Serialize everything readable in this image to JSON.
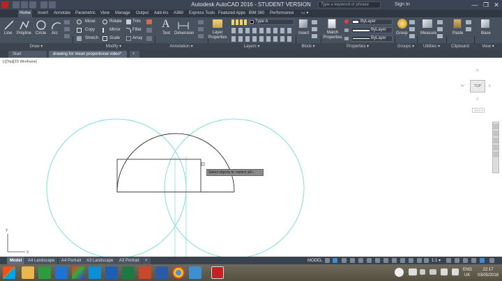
{
  "window": {
    "title": "Autodesk AutoCAD 2016 - STUDENT VERSION",
    "search_placeholder": "Type a keyword or phrase",
    "signin_label": "Sign In",
    "minimize": "—",
    "maximize": "❐",
    "close": "✕"
  },
  "menu": {
    "items": [
      "Home",
      "Insert",
      "Annotate",
      "Parametric",
      "View",
      "Manage",
      "Output",
      "Add-ins",
      "A360",
      "Express Tools",
      "Featured Apps",
      "BIM 360",
      "Performance"
    ],
    "extra": "▭ ▾"
  },
  "ribbon": {
    "draw": {
      "line": "Line",
      "polyline": "Polyline",
      "circle": "Circle",
      "arc": "Arc"
    },
    "modify": {
      "move": "Move",
      "rotate": "Rotate",
      "trim": "Trim",
      "copy": "Copy",
      "mirror": "Mirror",
      "fillet": "Fillet",
      "stretch": "Stretch",
      "scale": "Scale",
      "array": "Array"
    },
    "annotation": {
      "text": "Text",
      "dimension": "Dimension"
    },
    "layers": {
      "layer_properties": "Layer Properties",
      "layer_name": "Type A"
    },
    "block": {
      "insert": "Insert"
    },
    "properties": {
      "match_properties": "Match Properties",
      "color": "ByLayer",
      "linetype": "ByLayer",
      "lineweight": "ByLayer"
    },
    "groups": {
      "group": "Group"
    },
    "utilities": {
      "measure": "Measure"
    },
    "clipboard": {
      "paste": "Paste"
    },
    "view": {
      "base": "Base"
    },
    "panels": [
      "Draw ▾",
      "Modify ▾",
      "Annotation ▾",
      "Layers ▾",
      "Block ▾",
      "Properties ▾",
      "Groups ▾",
      "Utilities ▾",
      "Clipboard",
      "View ▾"
    ]
  },
  "doc_tabs": {
    "start": "Start",
    "drawing": "drawing for mean proportional video*",
    "add": "+"
  },
  "viewport": {
    "label": "[-][Top][2D Wireframe]",
    "cube_top": "TOP",
    "cube_n": "N",
    "cube_s": "S",
    "cube_w": "W",
    "cube_e": "E",
    "wcs": "WCS ▾"
  },
  "command_tooltip": "Select objects or <select all>:",
  "ucs": {
    "x": "X",
    "y": "Y"
  },
  "layout_tabs": {
    "tabs": [
      "Model",
      "A4 Landscape",
      "A4 Portrait",
      "A3 Landscape",
      "A3 Portrait"
    ],
    "add": "+"
  },
  "status_bar": {
    "model": "MODEL",
    "scale": "1:1 ▾"
  },
  "taskbar": {
    "language": "ENG",
    "region": "UK",
    "time": "22:17",
    "date": "03/05/2016"
  },
  "colors": {
    "accent_cyan": "#7fe0e0",
    "geometry": "#333333",
    "ribbon": "#48515e"
  }
}
